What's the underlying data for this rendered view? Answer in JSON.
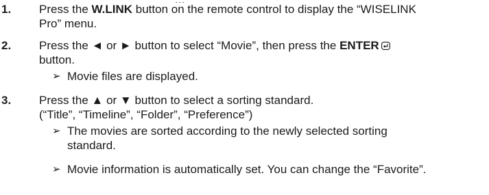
{
  "top_fragment": "...",
  "steps": [
    {
      "num": "1.",
      "line1_pre": "Press the ",
      "line1_bold": "W.LINK",
      "line1_post": " button on the remote control to display the “WISELINK",
      "line2": "Pro” menu."
    },
    {
      "num": "2.",
      "line1_pre": "Press the ◄ or ► button to select “Movie”, then press the ",
      "line1_bold": "ENTER",
      "line2": "button.",
      "note": "Movie files are displayed."
    },
    {
      "num": "3.",
      "line1": "Press the ▲ or ▼ button to select a sorting standard.",
      "line2": "(“Title”, “Timeline”, “Folder”, “Preference”)",
      "note1_line1": "The movies are sorted according to the newly selected sorting",
      "note1_line2": "standard.",
      "note2": "Movie information is automatically set. You can change the “Favorite”."
    }
  ],
  "arrow_symbol": "➢"
}
